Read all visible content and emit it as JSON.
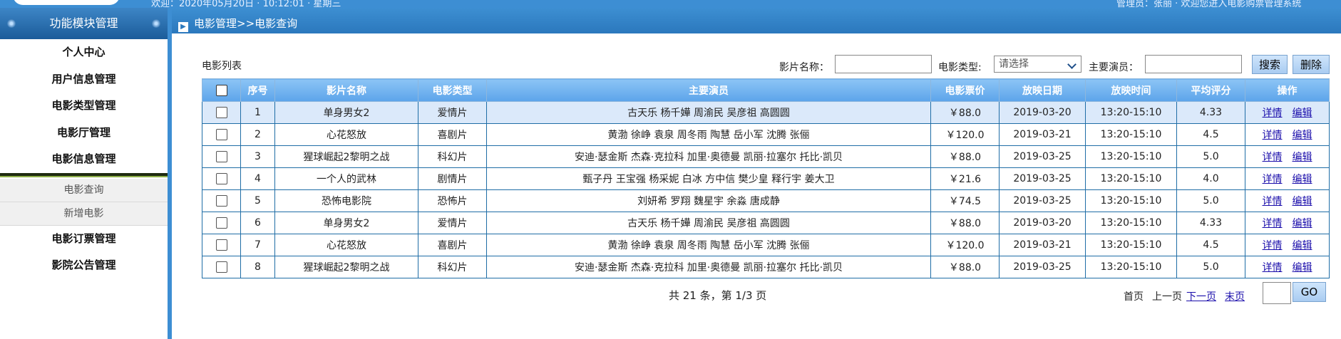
{
  "topbar": {
    "left_text": "欢迎：2020年05月20日 · 10:12:01 · 星期三",
    "right_text": "管理员：张丽 · 欢迎您进入电影购票管理系统"
  },
  "sidebar": {
    "title": "功能模块管理",
    "items": [
      "个人中心",
      "用户信息管理",
      "电影类型管理",
      "电影厅管理",
      "电影信息管理"
    ],
    "submenu": [
      "电影查询",
      "新增电影"
    ],
    "items_after": [
      "电影订票管理",
      "影院公告管理"
    ]
  },
  "header": {
    "breadcrumb": "电影管理>>电影查询"
  },
  "search": {
    "list_label": "电影列表",
    "name_label": "影片名称：",
    "name_value": "",
    "type_label": "电影类型:",
    "type_selected": "请选择",
    "actor_label": "主要演员：",
    "actor_value": "",
    "search_button": "搜索",
    "delete_button": "删除"
  },
  "table": {
    "columns": [
      "",
      "序号",
      "影片名称",
      "电影类型",
      "主要演员",
      "电影票价",
      "放映日期",
      "放映时间",
      "平均评分",
      "操作"
    ],
    "detail_label": "详情",
    "edit_label": "编辑",
    "rows": [
      {
        "no": "1",
        "name": "单身男女2",
        "type": "爱情片",
        "actors": "古天乐 杨千嬅 周渝民 吴彦祖 高圆圆",
        "price": "￥88.0",
        "date": "2019-03-20",
        "time": "13:20-15:10",
        "rating": "4.33"
      },
      {
        "no": "2",
        "name": "心花怒放",
        "type": "喜剧片",
        "actors": "黄渤 徐峥 袁泉 周冬雨 陶慧 岳小军 沈腾 张俪",
        "price": "￥120.0",
        "date": "2019-03-21",
        "time": "13:20-15:10",
        "rating": "4.5"
      },
      {
        "no": "3",
        "name": "猩球崛起2黎明之战",
        "type": "科幻片",
        "actors": "安迪·瑟金斯 杰森·克拉科 加里·奥德曼 凯丽·拉塞尔 托比·凯贝",
        "price": "￥88.0",
        "date": "2019-03-25",
        "time": "13:20-15:10",
        "rating": "5.0"
      },
      {
        "no": "4",
        "name": "一个人的武林",
        "type": "剧情片",
        "actors": "甄子丹 王宝强 杨采妮 白冰 方中信 樊少皇 释行宇 姜大卫",
        "price": "￥21.6",
        "date": "2019-03-25",
        "time": "13:20-15:10",
        "rating": "4.0"
      },
      {
        "no": "5",
        "name": "恐怖电影院",
        "type": "恐怖片",
        "actors": "刘妍希 罗翔 魏星宇 余淼 唐成静",
        "price": "￥74.5",
        "date": "2019-03-25",
        "time": "13:20-15:10",
        "rating": "5.0"
      },
      {
        "no": "6",
        "name": "单身男女2",
        "type": "爱情片",
        "actors": "古天乐 杨千嬅 周渝民 吴彦祖 高圆圆",
        "price": "￥88.0",
        "date": "2019-03-20",
        "time": "13:20-15:10",
        "rating": "4.33"
      },
      {
        "no": "7",
        "name": "心花怒放",
        "type": "喜剧片",
        "actors": "黄渤 徐峥 袁泉 周冬雨 陶慧 岳小军 沈腾 张俪",
        "price": "￥120.0",
        "date": "2019-03-21",
        "time": "13:20-15:10",
        "rating": "4.5"
      },
      {
        "no": "8",
        "name": "猩球崛起2黎明之战",
        "type": "科幻片",
        "actors": "安迪·瑟金斯 杰森·克拉科 加里·奥德曼 凯丽·拉塞尔 托比·凯贝",
        "price": "￥88.0",
        "date": "2019-03-25",
        "time": "13:20-15:10",
        "rating": "5.0"
      }
    ]
  },
  "footer": {
    "summary": "共 21 条，第 1/3 页",
    "first": "首页",
    "prev": "上一页",
    "next": "下一页",
    "last": "末页",
    "go_value": "",
    "go_button": "GO"
  }
}
